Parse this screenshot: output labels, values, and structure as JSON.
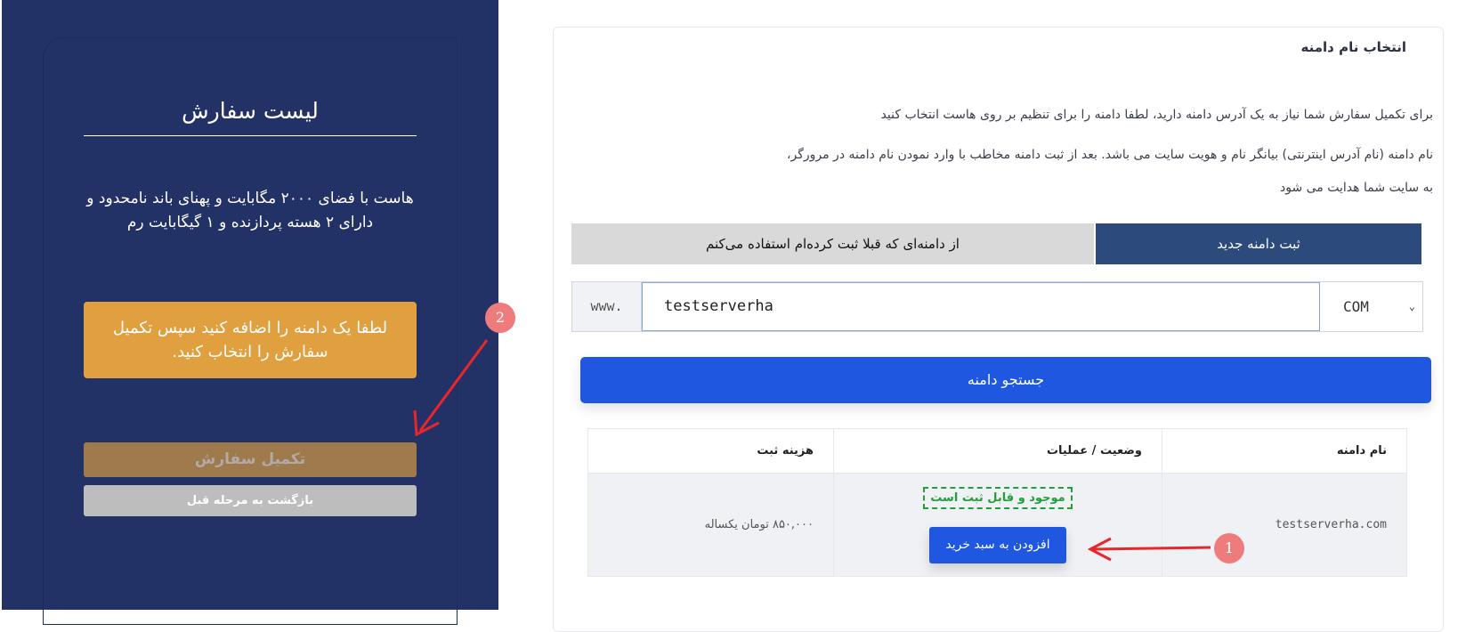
{
  "sidebar": {
    "title": "لیست سفارش",
    "description": "هاست با فضای ۲۰۰۰ مگابایت و پهنای باند نامحدود و دارای ۲ هسته پردازنده و ۱ گیگابایت رم",
    "warning": "لطفا یک دامنه را اضافه کنید سپس تکمیل سفارش را انتخاب کنید.",
    "complete_label": "تکمیل سفارش",
    "back_label": "بازگشت به مرحله قبل"
  },
  "main": {
    "heading": "انتخاب نام دامنه",
    "para1": "برای تکمیل سفارش شما نیاز به یک آدرس دامنه دارید، لطفا دامنه را برای تنظیم بر روی هاست انتخاب کنید",
    "para2a": "نام دامنه (نام آدرس اینترنتی) بیانگر نام و هویت سایت می باشد. بعد از ثبت دامنه مخاطب با وارد نمودن نام دامنه در مرورگر،",
    "para2b": "به سایت شما هدایت می شود",
    "tabs": [
      {
        "label": "ثبت دامنه جدید",
        "active": true
      },
      {
        "label": "از دامنه‌ای که قبلا ثبت کرده‌ام استفاده می‌کنم",
        "active": false
      }
    ],
    "prefix": "www.",
    "domain_value": "testserverha",
    "tld": "COM",
    "search_label": "جستجو دامنه",
    "table": {
      "headers": [
        "نام دامنه",
        "وضعیت / عملیات",
        "هزینه ثبت"
      ],
      "row": {
        "domain": "testserverha.com",
        "status": "موجود و قابل ثبت است",
        "action": "افزودن به سبد خرید",
        "price": "۸۵۰,۰۰۰ تومان یکساله"
      }
    }
  },
  "annotations": {
    "badge1": "1",
    "badge2": "2",
    "arrow_color": "#e8262b"
  },
  "colors": {
    "sidebar_bg": "#223166",
    "accent_blue": "#1f57e0",
    "warning": "#e1a03f",
    "available": "#1fa13a"
  }
}
